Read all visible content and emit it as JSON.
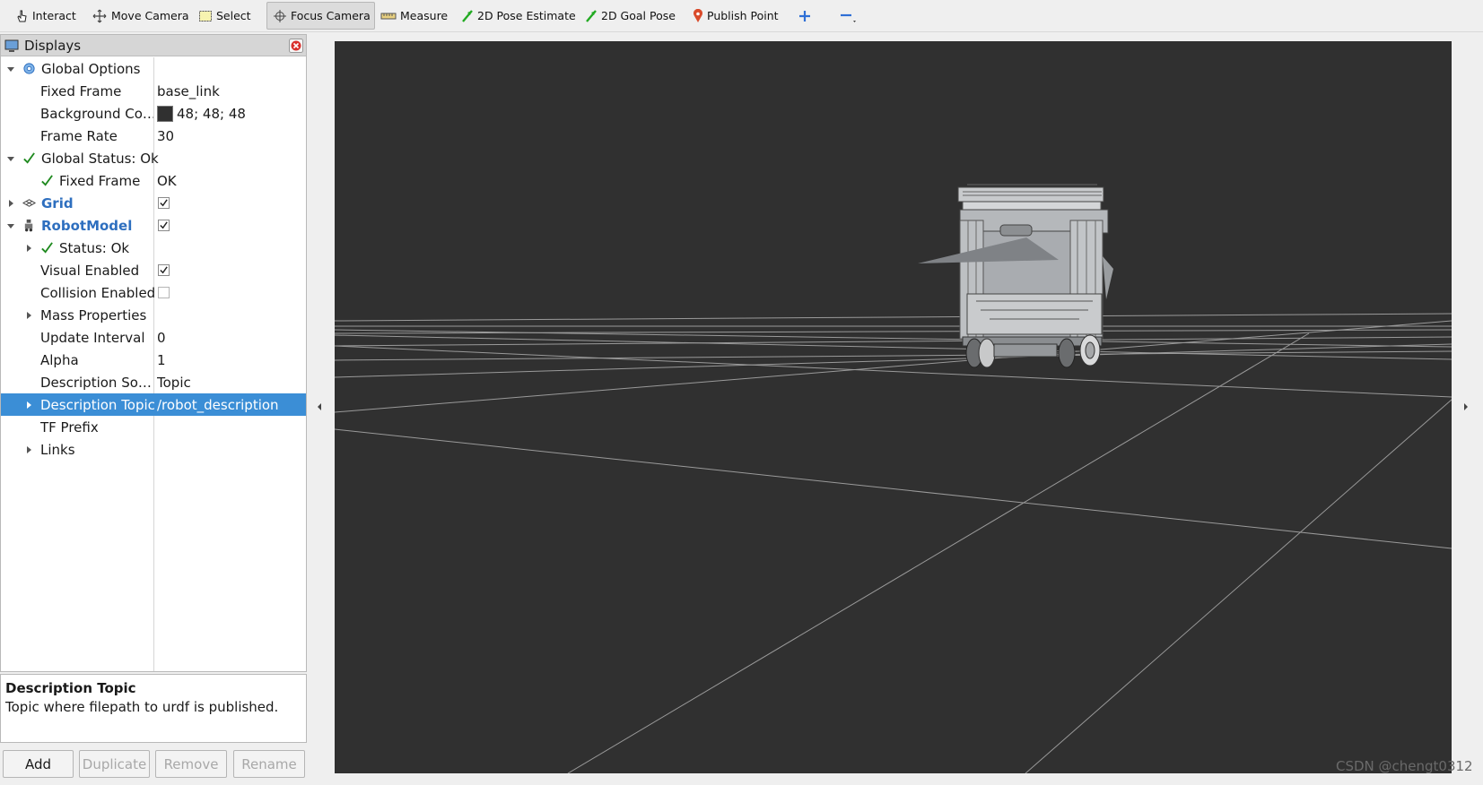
{
  "toolbar": {
    "items": [
      {
        "label": "Interact",
        "icon": "hand-pointer-icon"
      },
      {
        "label": "Move Camera",
        "icon": "move-camera-icon"
      },
      {
        "label": "Select",
        "icon": "select-box-icon"
      },
      {
        "label": "Focus Camera",
        "icon": "focus-crosshair-icon",
        "active": true
      },
      {
        "label": "Measure",
        "icon": "ruler-icon"
      },
      {
        "label": "2D Pose Estimate",
        "icon": "green-arrow-icon"
      },
      {
        "label": "2D Goal Pose",
        "icon": "green-arrow-icon"
      },
      {
        "label": "Publish Point",
        "icon": "map-pin-icon"
      }
    ],
    "add_tool_icon": "plus-icon",
    "remove_tool_icon": "minus-icon"
  },
  "displays": {
    "title": "Displays",
    "rows": [
      {
        "name": "Global Options",
        "value": ""
      },
      {
        "name": "Fixed Frame",
        "value": "base_link"
      },
      {
        "name": "Background Co…",
        "value": "48; 48; 48"
      },
      {
        "name": "Frame Rate",
        "value": "30"
      },
      {
        "name": "Global Status: Ok",
        "value": ""
      },
      {
        "name": "Fixed Frame",
        "value": "OK"
      },
      {
        "name": "Grid",
        "value": ""
      },
      {
        "name": "RobotModel",
        "value": ""
      },
      {
        "name": "Status: Ok",
        "value": ""
      },
      {
        "name": "Visual Enabled",
        "value": ""
      },
      {
        "name": "Collision Enabled",
        "value": ""
      },
      {
        "name": "Mass Properties",
        "value": ""
      },
      {
        "name": "Update Interval",
        "value": "0"
      },
      {
        "name": "Alpha",
        "value": "1"
      },
      {
        "name": "Description So…",
        "value": "Topic"
      },
      {
        "name": "Description Topic",
        "value": "/robot_description"
      },
      {
        "name": "TF Prefix",
        "value": ""
      },
      {
        "name": "Links",
        "value": ""
      }
    ],
    "checkboxes": {
      "grid": true,
      "robot_model": true,
      "visual_enabled": true,
      "collision_enabled": false
    },
    "background_color": "#303030"
  },
  "help": {
    "title": "Description Topic",
    "description": "Topic where filepath to urdf is published."
  },
  "buttons": {
    "add": "Add",
    "duplicate": "Duplicate",
    "remove": "Remove",
    "rename": "Rename"
  },
  "viewport": {
    "background": "#303030",
    "grid_color": "#a0a0a0"
  },
  "watermark": "CSDN @chengt0312"
}
